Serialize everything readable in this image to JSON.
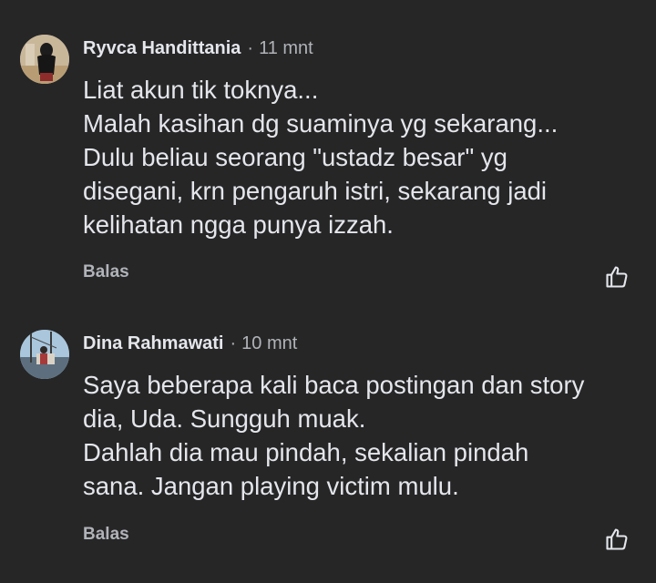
{
  "comments": [
    {
      "author": "Ryvca Handittania",
      "separator": "·",
      "time": "11 mnt",
      "lines": [
        "Liat akun tik toknya...",
        "Malah kasihan dg suaminya yg sekarang...",
        "Dulu beliau seorang \"ustadz besar\" yg",
        "disegani, krn pengaruh istri, sekarang jadi",
        "kelihatan ngga punya izzah."
      ],
      "reply_label": "Balas",
      "like_icon": "thumbs-up-outline-icon"
    },
    {
      "author": "Dina Rahmawati",
      "separator": "·",
      "time": "10 mnt",
      "lines": [
        "Saya beberapa kali baca postingan dan story",
        "dia, Uda. Sungguh muak.",
        "Dahlah dia mau pindah, sekalian pindah",
        "sana. Jangan playing victim mulu."
      ],
      "reply_label": "Balas",
      "like_icon": "thumbs-up-outline-icon"
    }
  ],
  "colors": {
    "background": "#262627",
    "primary_text": "#e4e6eb",
    "secondary_text": "#b0b3b8"
  }
}
